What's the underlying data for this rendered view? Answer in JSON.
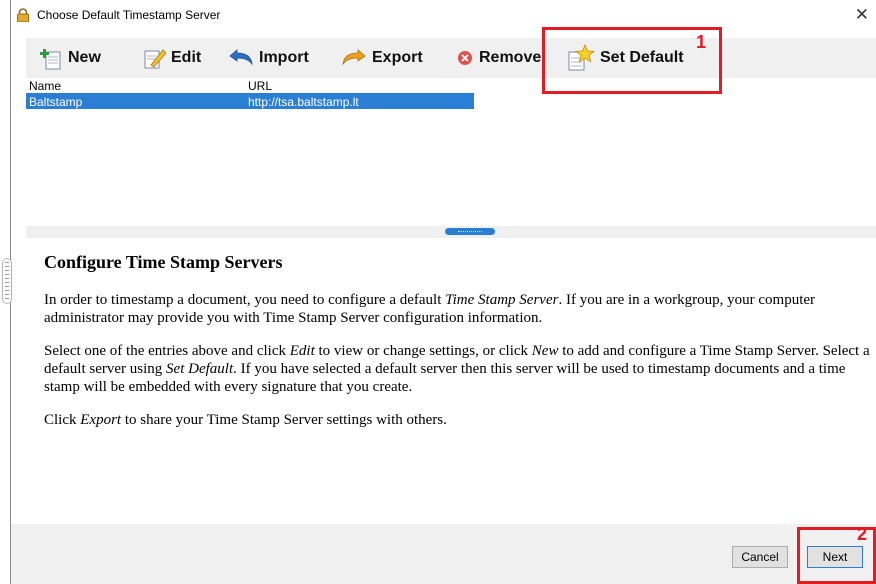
{
  "window": {
    "title": "Choose Default Timestamp Server"
  },
  "toolbar": {
    "new_label": "New",
    "edit_label": "Edit",
    "import_label": "Import",
    "export_label": "Export",
    "remove_label": "Remove",
    "set_default_label": "Set Default"
  },
  "table": {
    "columns": [
      "Name",
      "URL"
    ],
    "rows": [
      {
        "name": "Baltstamp",
        "url": "http://tsa.baltstamp.lt",
        "selected": true
      }
    ]
  },
  "help": {
    "heading": "Configure Time Stamp Servers",
    "p1_a": "In order to timestamp a document, you need to configure a default ",
    "p1_em": "Time Stamp Server",
    "p1_b": ". If you are in a workgroup, your computer administrator may provide you with Time Stamp Server configuration information.",
    "p2_a": "Select one of the entries above and click ",
    "p2_em1": "Edit",
    "p2_b": " to view or change settings, or click ",
    "p2_em2": "New",
    "p2_c": " to add and configure a Time Stamp Server. Select a default server using ",
    "p2_em3": "Set Default",
    "p2_d": ". If you have selected a default server then this server will be used to timestamp documents and a time stamp will be embedded with every signature that you create.",
    "p3_a": "Click ",
    "p3_em": "Export",
    "p3_b": " to share your Time Stamp Server settings with others."
  },
  "footer": {
    "cancel_label": "Cancel",
    "next_label": "Next"
  },
  "annotations": [
    {
      "label": "1",
      "color": "#e31b23"
    },
    {
      "label": "2",
      "color": "#e31b23"
    }
  ],
  "colors": {
    "selection": "#2a7fd4",
    "toolbar_bg": "#f0f0f0",
    "annotation": "#e31b23"
  }
}
